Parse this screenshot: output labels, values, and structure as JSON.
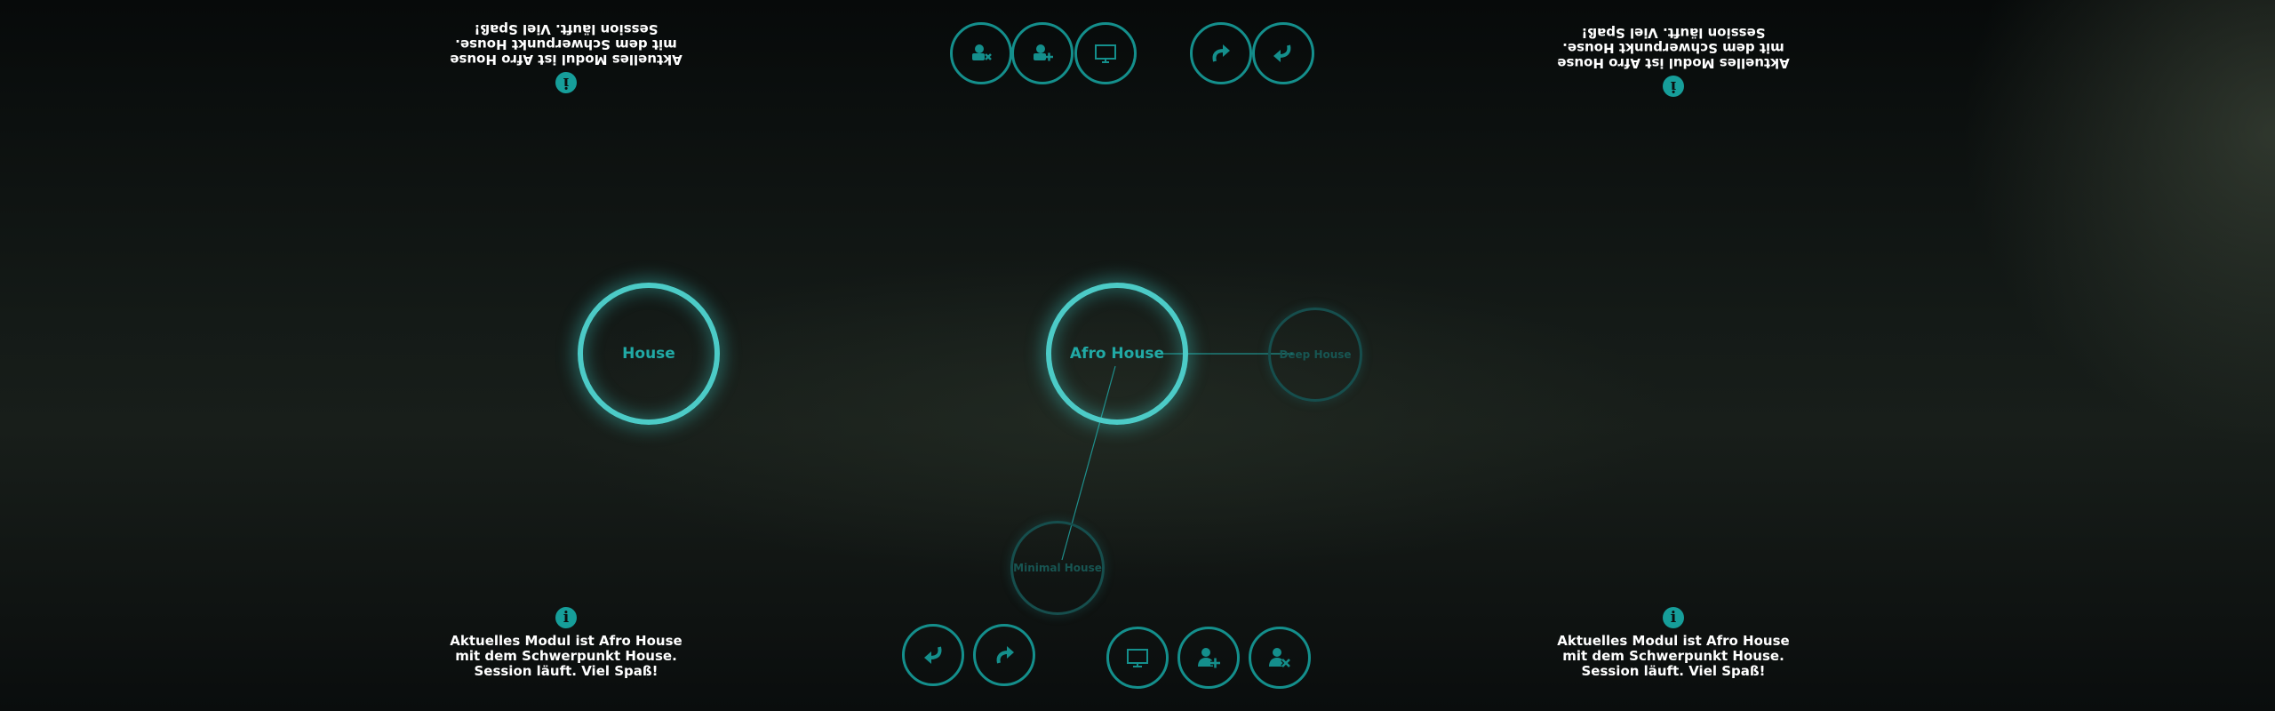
{
  "accent_color": "#148f8c",
  "active_ring_color": "#4ccbc7",
  "info_message": [
    "Aktuelles Modul ist Afro House",
    "mit dem Schwerpunkt House.",
    "Session läuft. Viel Spaß!"
  ],
  "info_icon": "info-circle-icon",
  "nodes": {
    "house": "House",
    "afro_house": "Afro House",
    "deep_house": "Deep House",
    "minimal_house": "Minimal House"
  },
  "top_toolbar": [
    {
      "icon": "remove-camera-icon"
    },
    {
      "icon": "add-camera-icon"
    },
    {
      "icon": "tv-icon"
    },
    {
      "icon": "undo-icon"
    },
    {
      "icon": "redo-icon"
    }
  ],
  "bottom_toolbar": [
    {
      "icon": "undo-icon"
    },
    {
      "icon": "redo-icon"
    },
    {
      "icon": "monitor-icon"
    },
    {
      "icon": "add-user-icon"
    },
    {
      "icon": "remove-user-icon"
    }
  ]
}
